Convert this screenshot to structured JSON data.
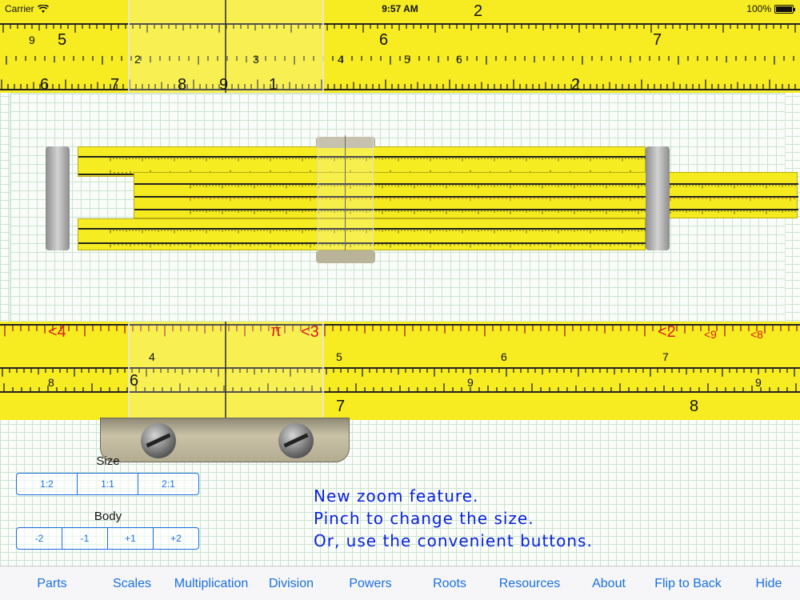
{
  "status": {
    "carrier": "Carrier",
    "time": "9:57 AM",
    "battery_percent": "100%",
    "battery_level": 1.0
  },
  "big_rule": {
    "top_labels": [
      {
        "text": "9",
        "cls": "small"
      },
      {
        "text": "5",
        "cls": ""
      },
      {
        "text": "6",
        "cls": ""
      },
      {
        "text": "7",
        "cls": ""
      },
      {
        "text": "2",
        "cls": "small"
      },
      {
        "text": "3",
        "cls": "small"
      },
      {
        "text": "4",
        "cls": "small"
      },
      {
        "text": "5",
        "cls": "small"
      },
      {
        "text": "6",
        "cls": "small"
      },
      {
        "text": "6",
        "cls": ""
      },
      {
        "text": "7",
        "cls": ""
      },
      {
        "text": "8",
        "cls": ""
      },
      {
        "text": "9",
        "cls": ""
      },
      {
        "text": "1",
        "cls": ""
      },
      {
        "text": "2",
        "cls": ""
      },
      {
        "text": "2",
        "cls": ""
      }
    ],
    "bottom_labels": [
      {
        "text": "<4",
        "cls": "red"
      },
      {
        "text": "π",
        "cls": "red"
      },
      {
        "text": "<3",
        "cls": "red"
      },
      {
        "text": "<2",
        "cls": "red"
      },
      {
        "text": "<9",
        "cls": "red small"
      },
      {
        "text": "<8",
        "cls": "red small"
      },
      {
        "text": "4",
        "cls": "small"
      },
      {
        "text": "5",
        "cls": "small"
      },
      {
        "text": "6",
        "cls": "small"
      },
      {
        "text": "7",
        "cls": "small"
      },
      {
        "text": "8",
        "cls": "small"
      },
      {
        "text": "9",
        "cls": "small"
      },
      {
        "text": "9",
        "cls": "small"
      },
      {
        "text": "6",
        "cls": ""
      },
      {
        "text": "7",
        "cls": ""
      },
      {
        "text": "8",
        "cls": ""
      }
    ]
  },
  "controls": {
    "size_title": "Size",
    "size_options": [
      "1:2",
      "1:1",
      "2:1"
    ],
    "body_title": "Body",
    "body_options": [
      "-2",
      "-1",
      "+1",
      "+2"
    ]
  },
  "message": {
    "line1": "New zoom feature.",
    "line2": "Pinch to change the size.",
    "line3": "Or, use the convenient buttons."
  },
  "tabs": [
    "Parts",
    "Scales",
    "Multiplication",
    "Division",
    "Powers",
    "Roots",
    "Resources",
    "About",
    "Flip to Back",
    "Hide"
  ],
  "colors": {
    "rule_yellow": "#f7ec22",
    "accent_blue": "#1a6fe0",
    "message_blue": "#0a22d8",
    "red_scale": "#d61f1f"
  }
}
